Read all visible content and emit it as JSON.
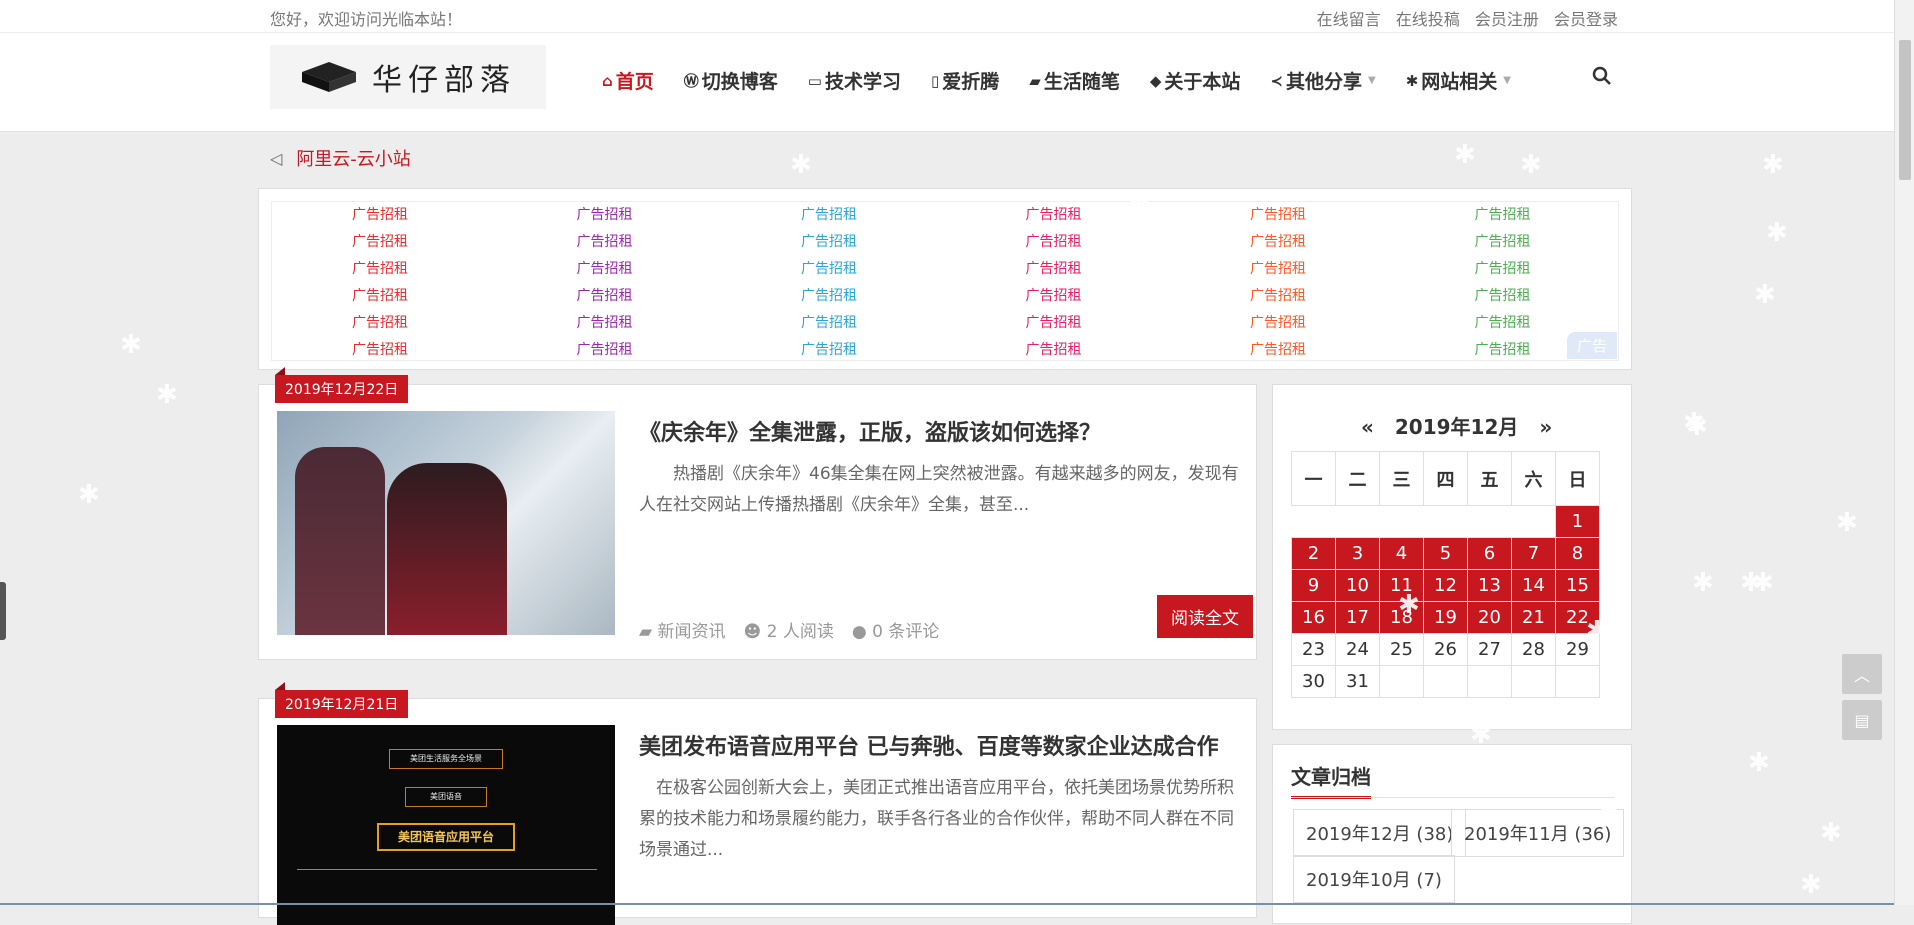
{
  "top": {
    "welcome": "您好，欢迎访问光临本站！",
    "links": [
      "在线留言",
      "在线投稿",
      "会员注册",
      "会员登录"
    ]
  },
  "logo": {
    "text": "华仔部落"
  },
  "nav": [
    {
      "label": "首页",
      "icon": "home-icon"
    },
    {
      "label": "切换博客",
      "icon": "wordpress-icon"
    },
    {
      "label": "技术学习",
      "icon": "desktop-icon"
    },
    {
      "label": "爱折腾",
      "icon": "tablet-icon"
    },
    {
      "label": "生活随笔",
      "icon": "book-icon"
    },
    {
      "label": "关于本站",
      "icon": "tag-icon"
    },
    {
      "label": "其他分享",
      "icon": "share-icon"
    },
    {
      "label": "网站相关",
      "icon": "gear-icon"
    }
  ],
  "notice": {
    "text": "阿里云-云小站"
  },
  "ads": {
    "label": "广告招租",
    "tag": "广告",
    "colors": [
      "#e52e2e",
      "#9c27b0",
      "#2aa7d8",
      "#e91e63",
      "#ff5722",
      "#4caf50"
    ]
  },
  "posts": [
    {
      "date": "2019年12月22日",
      "title": "《庆余年》全集泄露，正版，盗版该如何选择？",
      "excerpt": "热播剧《庆余年》46集全集在网上突然被泄露。有越来越多的网友，发现有人在社交网站上传播热播剧《庆余年》全集，甚至...",
      "category": "新闻资讯",
      "reads": "2 人阅读",
      "comments": "0 条评论",
      "readmore": "阅读全文"
    },
    {
      "date": "2019年12月21日",
      "title": "美团发布语音应用平台 已与奔驰、百度等数家企业达成合作",
      "excerpt": "在极客公园创新大会上，美团正式推出语音应用平台，依托美团场景优势所积累的技术能力和场景履约能力，联手各行各业的合作伙伴，帮助不同人群在不同场景通过...",
      "image_box_top": "美团生活服务全场景",
      "image_box_mid": "美团语音",
      "image_box_main": "美团语音应用平台"
    }
  ],
  "calendar": {
    "prev": "«",
    "next": "»",
    "month": "2019年12月",
    "weekdays": [
      "一",
      "二",
      "三",
      "四",
      "五",
      "六",
      "日"
    ]
  },
  "archive": {
    "title": "文章归档",
    "items": [
      "2019年12月 (38)",
      "2019年11月 (36)",
      "2019年10月 (7)"
    ]
  }
}
